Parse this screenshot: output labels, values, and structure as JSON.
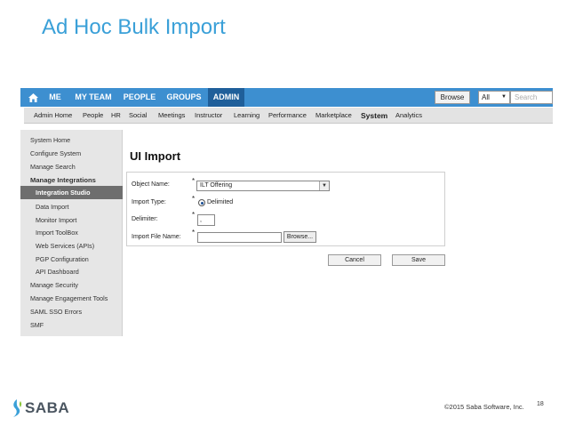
{
  "slide": {
    "title": "Ad Hoc Bulk Import",
    "copyright": "©2015 Saba Software, Inc.",
    "page_number": "18",
    "logo_text": "SABA"
  },
  "colors": {
    "title": "#3aa0d8",
    "topnav": "#3d8fd0",
    "topnav_active": "#1f5f9a",
    "sidebar_active": "#6e6e6e"
  },
  "topnav": {
    "home_icon": "home-icon",
    "items": [
      "ME",
      "MY TEAM",
      "PEOPLE",
      "GROUPS",
      "ADMIN"
    ],
    "active": "ADMIN",
    "browse_label": "Browse",
    "scope_value": "All",
    "search_placeholder": "Search"
  },
  "subnav": {
    "items": [
      "Admin Home",
      "People",
      "HR",
      "Social",
      "Meetings",
      "Instructor",
      "Learning",
      "Performance",
      "Marketplace",
      "System",
      "Analytics"
    ],
    "active": "System"
  },
  "sidebar": {
    "items": [
      {
        "label": "System Home"
      },
      {
        "label": "Configure System"
      },
      {
        "label": "Manage Search"
      },
      {
        "label": "Manage Integrations"
      },
      {
        "label": "Integration Studio"
      },
      {
        "label": "Data Import"
      },
      {
        "label": "Monitor Import"
      },
      {
        "label": "Import ToolBox"
      },
      {
        "label": "Web Services (APIs)"
      },
      {
        "label": "PGP Configuration"
      },
      {
        "label": "API Dashboard"
      },
      {
        "label": "Manage Security"
      },
      {
        "label": "Manage Engagement Tools"
      },
      {
        "label": "SAML SSO Errors"
      },
      {
        "label": "SMF"
      }
    ]
  },
  "main": {
    "title": "UI Import",
    "form": {
      "object_name_label": "Object Name:",
      "object_name_value": "ILT Offering",
      "import_type_label": "Import Type:",
      "import_type_value": "Delimited",
      "delimiter_label": "Delimiter:",
      "delimiter_value": ",",
      "file_label": "Import File Name:",
      "file_value": "",
      "browse_label": "Browse...",
      "required_mark": "*"
    },
    "cancel_label": "Cancel",
    "save_label": "Save"
  }
}
